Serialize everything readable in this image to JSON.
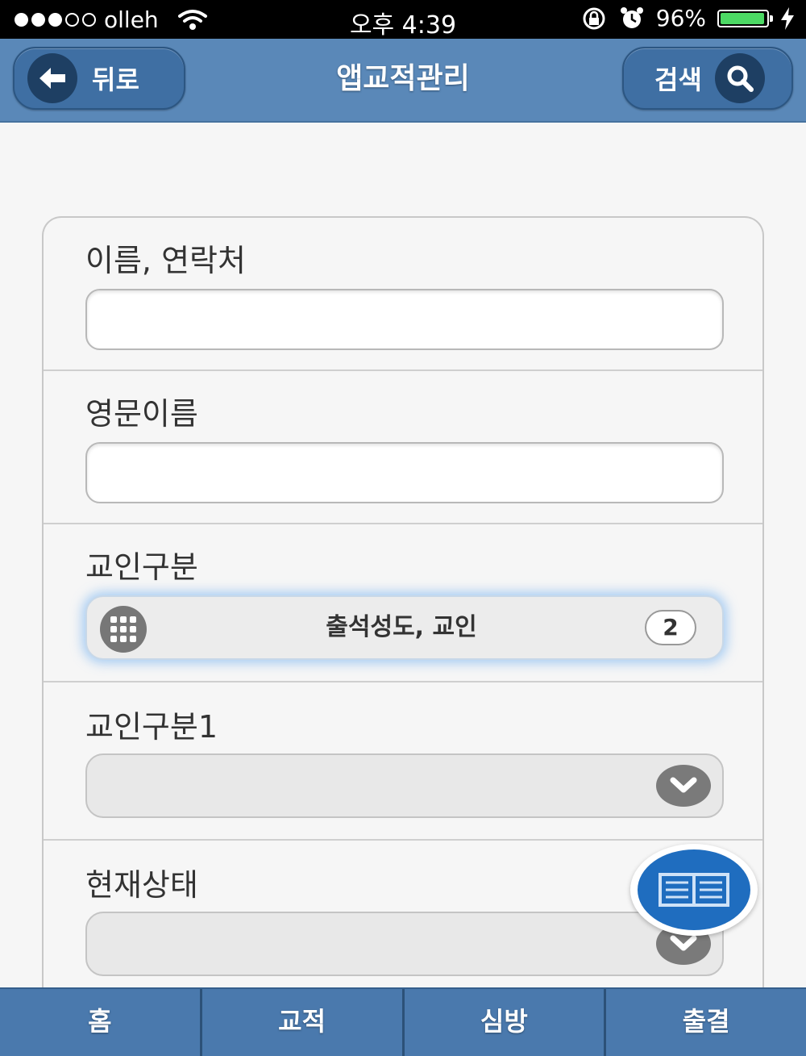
{
  "status_bar": {
    "carrier": "olleh",
    "time": "오후 4:39",
    "battery": "96%",
    "battery_level": 0.96,
    "signal_bars": 3,
    "signal_total": 5
  },
  "header": {
    "title": "앱교적관리",
    "back_label": "뒤로",
    "search_label": "검색"
  },
  "form": {
    "fields": [
      {
        "label": "이름, 연락처",
        "type": "text",
        "value": ""
      },
      {
        "label": "영문이름",
        "type": "text",
        "value": ""
      },
      {
        "label": "교인구분",
        "type": "multiselect",
        "value": "출석성도, 교인",
        "count": "2"
      },
      {
        "label": "교인구분1",
        "type": "select",
        "value": ""
      },
      {
        "label": "현재상태",
        "type": "select",
        "value": ""
      }
    ]
  },
  "tabbar": {
    "tabs": [
      {
        "label": "홈"
      },
      {
        "label": "교적"
      },
      {
        "label": "심방"
      },
      {
        "label": "출결"
      }
    ]
  },
  "colors": {
    "header_bg": "#5a88b8",
    "tabbar_bg": "#4a79ad",
    "fab": "#1f6dbf",
    "battery": "#4cd964"
  },
  "icons": {
    "back": "arrow-left-icon",
    "search": "search-icon",
    "multiselect": "grid-icon",
    "select": "chevron-down-icon",
    "fab": "book-icon"
  }
}
